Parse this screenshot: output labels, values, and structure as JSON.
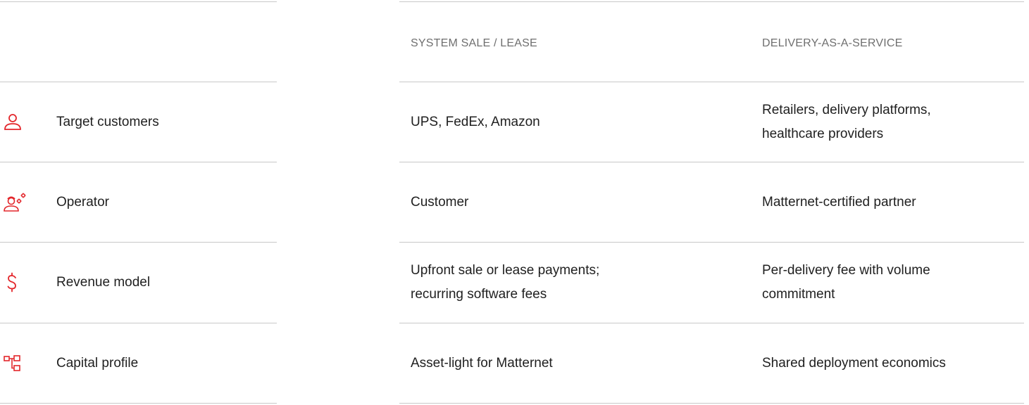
{
  "columns": {
    "sale": "SYSTEM SALE / LEASE",
    "daas": "DELIVERY-AS-A-SERVICE"
  },
  "rows": [
    {
      "label": "Target customers",
      "icon": "person-icon",
      "sale": "UPS, FedEx, Amazon",
      "daas_line1": "Retailers, delivery platforms,",
      "daas_line2": "healthcare providers"
    },
    {
      "label": "Operator",
      "icon": "operator-gears-icon",
      "sale": "Customer",
      "daas_line1": "Matternet-certified partner"
    },
    {
      "label": "Revenue model",
      "icon": "dollar-icon",
      "sale_line1": "Upfront sale or lease payments;",
      "sale_line2": "recurring software fees",
      "daas_line1": "Per-delivery fee with volume",
      "daas_line2": "commitment"
    },
    {
      "label": "Capital profile",
      "icon": "hierarchy-icon",
      "sale": "Asset-light for Matternet",
      "daas_line1": "Shared deployment economics"
    }
  ],
  "colors": {
    "accent": "#e3262b",
    "rule": "#c8c8c8",
    "header_text": "#6f6f6f"
  }
}
